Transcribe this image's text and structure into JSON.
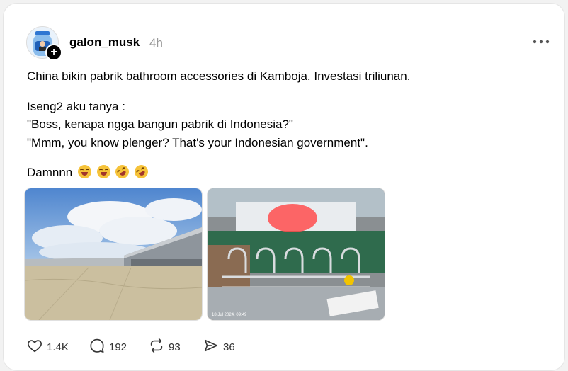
{
  "post": {
    "username": "galon_musk",
    "time": "4h",
    "paragraphs": [
      "China bikin pabrik bathroom accessories di Kamboja. Investasi triliunan.",
      "Iseng2 aku tanya :",
      "\"Boss, kenapa ngga bangun pabrik di Indonesia?\"",
      "\"Mmm, you know plenger? That's your Indonesian government\".",
      "Damnnn"
    ],
    "emojis": [
      "laughing-face-icon",
      "laughing-face-icon",
      "rolling-on-floor-laughing-icon",
      "rolling-on-floor-laughing-icon"
    ],
    "photo2_timestamp": "18 Jul 2024, 09:49"
  },
  "actions": {
    "likes": "1.4K",
    "replies": "192",
    "reposts": "93",
    "shares": "36"
  },
  "colors": {
    "card_bg": "#ffffff",
    "muted": "#999999",
    "sky": "#5e93d6"
  }
}
